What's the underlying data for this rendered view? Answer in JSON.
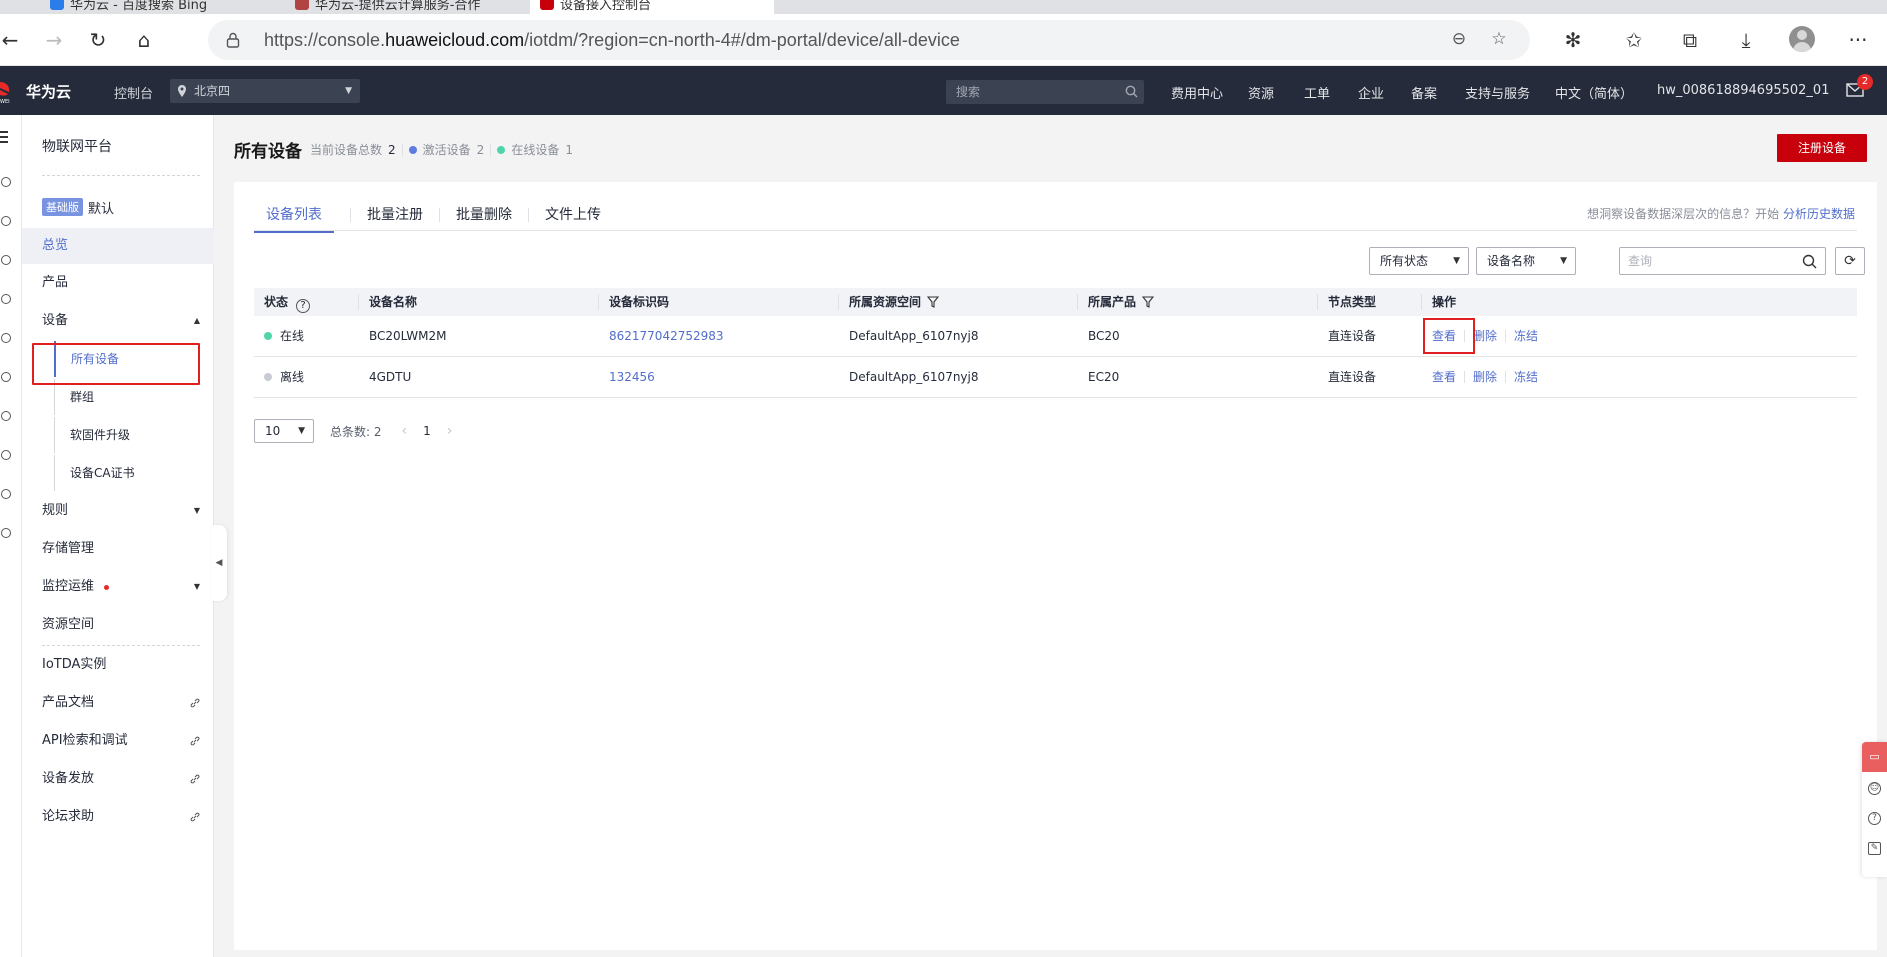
{
  "browser": {
    "tabs": [
      {
        "label": "华为云 - 百度搜索 Bing",
        "active": false
      },
      {
        "label": "华为云-提供云计算服务-合作",
        "active": false
      },
      {
        "label": "设备接入控制台",
        "active": true
      }
    ],
    "url_prefix": "https://console.",
    "url_host": "huaweicloud.com",
    "url_path": "/iotdm/?region=cn-north-4#/dm-portal/device/all-device"
  },
  "topnav": {
    "brand": "华为云",
    "console": "控制台",
    "region": "北京四",
    "search_placeholder": "搜索",
    "links": [
      "费用中心",
      "资源",
      "工单",
      "企业",
      "备案",
      "支持与服务",
      "中文（简体）"
    ],
    "username": "hw_008618894695502_01",
    "mail_count": "2"
  },
  "sidebar": {
    "title": "物联网平台",
    "edition_tag": "基础版",
    "edition_name": "默认",
    "items": {
      "overview": "总览",
      "product": "产品",
      "device": "设备",
      "all_devices": "所有设备",
      "group": "群组",
      "firmware": "软固件升级",
      "ca_cert": "设备CA证书",
      "rules": "规则",
      "storage": "存储管理",
      "monitor": "监控运维",
      "resource_space": "资源空间",
      "iotda_instance": "IoTDA实例",
      "product_docs": "产品文档",
      "api_explorer": "API检索和调试",
      "provisioning": "设备发放",
      "forum": "论坛求助"
    }
  },
  "page": {
    "title": "所有设备",
    "total_label": "当前设备总数",
    "total_count": "2",
    "activated_label": "激活设备",
    "activated_count": "2",
    "online_label": "在线设备",
    "online_count": "1",
    "register_button": "注册设备"
  },
  "tabs": [
    "设备列表",
    "批量注册",
    "批量删除",
    "文件上传"
  ],
  "insight": {
    "text": "想洞察设备数据深层次的信息？开始",
    "link": "分析历史数据"
  },
  "filters": {
    "status": "所有状态",
    "field": "设备名称",
    "query_placeholder": "查询"
  },
  "table": {
    "headers": {
      "status": "状态",
      "name": "设备名称",
      "node_id": "设备标识码",
      "space": "所属资源空间",
      "product": "所属产品",
      "node_type": "节点类型",
      "actions": "操作"
    },
    "rows": [
      {
        "status": "在线",
        "status_color": "#50d4ab",
        "name": "BC20LWM2M",
        "node_id": "862177042752983",
        "space": "DefaultApp_6107nyj8",
        "product": "BC20",
        "node_type": "直连设备",
        "view": "查看",
        "delete": "删除",
        "freeze": "冻结"
      },
      {
        "status": "离线",
        "status_color": "#c9ccd3",
        "name": "4GDTU",
        "node_id": "132456",
        "space": "DefaultApp_6107nyj8",
        "product": "EC20",
        "node_type": "直连设备",
        "view": "查看",
        "delete": "删除",
        "freeze": "冻结"
      }
    ]
  },
  "pager": {
    "page_size": "10",
    "total_label": "总条数: 2",
    "current_page": "1"
  },
  "colors": {
    "accent": "#526ecc",
    "brand_red": "#c7000b",
    "online": "#50d4ab",
    "activated": "#5e7ce0",
    "topbar": "#252b3a"
  }
}
